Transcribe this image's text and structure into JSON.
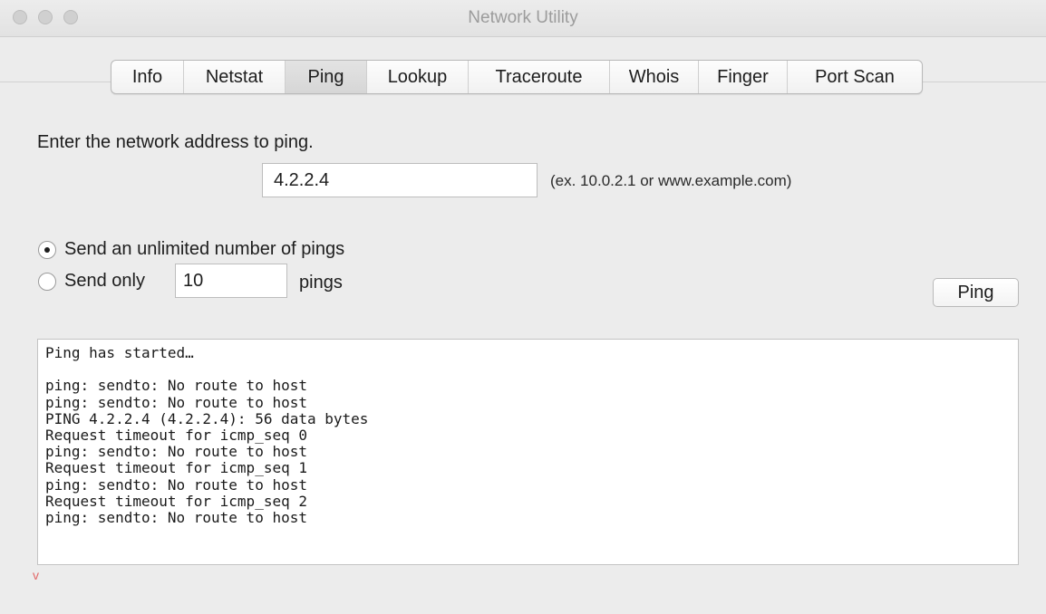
{
  "window": {
    "title": "Network Utility"
  },
  "tabs": [
    {
      "label": "Info",
      "active": false
    },
    {
      "label": "Netstat",
      "active": false
    },
    {
      "label": "Ping",
      "active": true
    },
    {
      "label": "Lookup",
      "active": false
    },
    {
      "label": "Traceroute",
      "active": false
    },
    {
      "label": "Whois",
      "active": false
    },
    {
      "label": "Finger",
      "active": false
    },
    {
      "label": "Port Scan",
      "active": false
    }
  ],
  "ping": {
    "prompt": "Enter the network address to ping.",
    "address_value": "4.2.2.4",
    "address_hint": "(ex. 10.0.2.1 or www.example.com)",
    "unlimited_label": "Send an unlimited number of pings",
    "limited_label_before": "Send only",
    "limited_count": "10",
    "limited_label_after": "pings",
    "selected_option": "unlimited",
    "button_label": "Ping"
  },
  "output": {
    "lines": [
      "Ping has started…",
      "",
      "ping: sendto: No route to host",
      "ping: sendto: No route to host",
      "PING 4.2.2.4 (4.2.2.4): 56 data bytes",
      "Request timeout for icmp_seq 0",
      "ping: sendto: No route to host",
      "Request timeout for icmp_seq 1",
      "ping: sendto: No route to host",
      "Request timeout for icmp_seq 2",
      "ping: sendto: No route to host"
    ]
  },
  "footer": {
    "mark": "v"
  }
}
